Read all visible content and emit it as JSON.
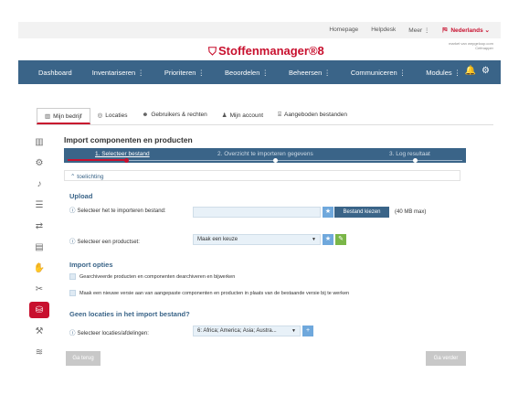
{
  "topbar": {
    "links": [
      "Homepage",
      "Helpdesk",
      "Meer ⋮"
    ],
    "language": "Nederlands",
    "language_caret": "⌄"
  },
  "logo": {
    "text": "Stoffenmanager®8"
  },
  "partner": {
    "line1": "market van wepgeloop.com",
    "line2": "Cefmapper"
  },
  "nav": {
    "items": [
      "Dashboard",
      "Inventariseren ⋮",
      "Prioriteren ⋮",
      "Beoordelen ⋮",
      "Beheersen ⋮",
      "Communiceren ⋮",
      "Modules ⋮"
    ]
  },
  "tabs": [
    {
      "label": "Mijn bedrijf",
      "icon": "building-icon"
    },
    {
      "label": "Locaties",
      "icon": "binoculars-icon"
    },
    {
      "label": "Gebruikers & rechten",
      "icon": "users-icon"
    },
    {
      "label": "Mijn account",
      "icon": "user-icon"
    },
    {
      "label": "Aangeboden bestanden",
      "icon": "inbox-icon"
    }
  ],
  "sidebar": {
    "icons": [
      "building-icon",
      "gear-icon",
      "bell-icon",
      "list-icon",
      "share-icon",
      "book-icon",
      "handshake-icon",
      "tools-icon",
      "database-sync-icon",
      "hammer-icon",
      "layers-icon"
    ],
    "active_index": 8
  },
  "main": {
    "title": "Import componenten en producten",
    "steps": [
      "1. Selecteer bestand",
      "2. Overzicht te importeren gegevens",
      "3. Log resultaat"
    ],
    "toelichting": "toelichting",
    "upload": {
      "heading": "Upload",
      "file_label": "Selecteer het te importeren bestand:",
      "choose_button": "Bestand kiezen",
      "max_size": "(40 MB max)"
    },
    "productset": {
      "label": "Selecteer een productset:",
      "value": "Maak een keuze"
    },
    "import_options": {
      "heading": "Import opties",
      "options": [
        "Gearchiveerde producten en componenten dearchiveren en bijwerken",
        "Maak een nieuwe versie aan van aangepaste componenten en producten in plaats van de bestaande versie bij te werken"
      ]
    },
    "locations": {
      "heading": "Geen locaties in het import bestand?",
      "label": "Selecteer locaties/afdelingen:",
      "value": "6: Africa; America; Asia; Austra..."
    },
    "back_button": "Ga terug",
    "next_button": "Ga verder"
  }
}
